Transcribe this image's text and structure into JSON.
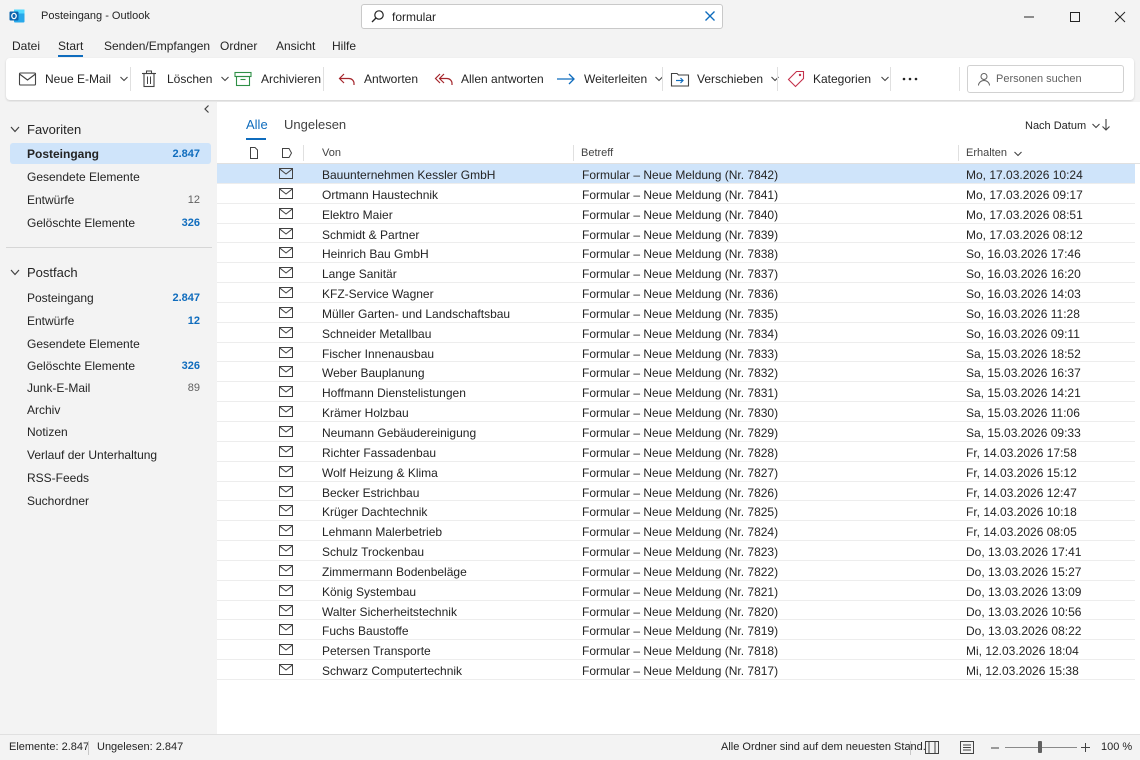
{
  "window": {
    "title": "Posteingang - Outlook",
    "search_value": "formular"
  },
  "menu": [
    "Datei",
    "Start",
    "Senden/Empfangen",
    "Ordner",
    "Ansicht",
    "Hilfe"
  ],
  "ribbon": {
    "new_mail": "Neue E-Mail",
    "delete": "Löschen",
    "archive": "Archivieren",
    "reply": "Antworten",
    "reply_all": "Allen antworten",
    "forward": "Weiterleiten",
    "move": "Verschieben",
    "categories": "Kategorien",
    "people_search": "Personen suchen"
  },
  "sidebar": {
    "favorites_title": "Favoriten",
    "favorites": [
      {
        "label": "Posteingang",
        "count": "2.847"
      },
      {
        "label": "Gesendete Elemente",
        "count": ""
      },
      {
        "label": "Entwürfe",
        "count": "12"
      },
      {
        "label": "Gelöschte Elemente",
        "count": "326"
      }
    ],
    "mailbox_title": "Postfach",
    "mailbox": [
      {
        "label": "Posteingang",
        "count": "2.847"
      },
      {
        "label": "Entwürfe",
        "count": "12"
      },
      {
        "label": "Gesendete Elemente",
        "count": ""
      },
      {
        "label": "Gelöschte Elemente",
        "count": "326"
      },
      {
        "label": "Junk-E-Mail",
        "count": "89"
      },
      {
        "label": "Archiv",
        "count": ""
      },
      {
        "label": "Notizen",
        "count": ""
      },
      {
        "label": "Verlauf der Unterhaltung",
        "count": ""
      },
      {
        "label": "RSS-Feeds",
        "count": ""
      },
      {
        "label": "Suchordner",
        "count": ""
      }
    ]
  },
  "list": {
    "tab_all": "Alle",
    "tab_unread": "Ungelesen",
    "sort_label": "Nach Datum",
    "col_from": "Von",
    "col_subject": "Betreff",
    "col_received": "Erhalten",
    "messages": [
      {
        "from": "Bauunternehmen Kessler GmbH",
        "subject": "Formular – Neue Meldung (Nr. 7842)",
        "date": "Mo, 17.03.2026 10:24"
      },
      {
        "from": "Ortmann Haustechnik",
        "subject": "Formular – Neue Meldung (Nr. 7841)",
        "date": "Mo, 17.03.2026 09:17"
      },
      {
        "from": "Elektro Maier",
        "subject": "Formular – Neue Meldung (Nr. 7840)",
        "date": "Mo, 17.03.2026 08:51"
      },
      {
        "from": "Schmidt & Partner",
        "subject": "Formular – Neue Meldung (Nr. 7839)",
        "date": "Mo, 17.03.2026 08:12"
      },
      {
        "from": "Heinrich Bau GmbH",
        "subject": "Formular – Neue Meldung (Nr. 7838)",
        "date": "So, 16.03.2026 17:46"
      },
      {
        "from": "Lange Sanitär",
        "subject": "Formular – Neue Meldung (Nr. 7837)",
        "date": "So, 16.03.2026 16:20"
      },
      {
        "from": "KFZ-Service Wagner",
        "subject": "Formular – Neue Meldung (Nr. 7836)",
        "date": "So, 16.03.2026 14:03"
      },
      {
        "from": "Müller Garten- und Landschaftsbau",
        "subject": "Formular – Neue Meldung (Nr. 7835)",
        "date": "So, 16.03.2026 11:28"
      },
      {
        "from": "Schneider Metallbau",
        "subject": "Formular – Neue Meldung (Nr. 7834)",
        "date": "So, 16.03.2026 09:11"
      },
      {
        "from": "Fischer Innenausbau",
        "subject": "Formular – Neue Meldung (Nr. 7833)",
        "date": "Sa, 15.03.2026 18:52"
      },
      {
        "from": "Weber Bauplanung",
        "subject": "Formular – Neue Meldung (Nr. 7832)",
        "date": "Sa, 15.03.2026 16:37"
      },
      {
        "from": "Hoffmann Dienstelistungen",
        "subject": "Formular – Neue Meldung (Nr. 7831)",
        "date": "Sa, 15.03.2026 14:21"
      },
      {
        "from": "Krämer Holzbau",
        "subject": "Formular – Neue Meldung (Nr. 7830)",
        "date": "Sa, 15.03.2026 11:06"
      },
      {
        "from": "Neumann Gebäudereinigung",
        "subject": "Formular – Neue Meldung (Nr. 7829)",
        "date": "Sa, 15.03.2026 09:33"
      },
      {
        "from": "Richter Fassadenbau",
        "subject": "Formular – Neue Meldung (Nr. 7828)",
        "date": "Fr, 14.03.2026 17:58"
      },
      {
        "from": "Wolf Heizung & Klima",
        "subject": "Formular – Neue Meldung (Nr. 7827)",
        "date": "Fr, 14.03.2026 15:12"
      },
      {
        "from": "Becker Estrichbau",
        "subject": "Formular – Neue Meldung (Nr. 7826)",
        "date": "Fr, 14.03.2026 12:47"
      },
      {
        "from": "Krüger Dachtechnik",
        "subject": "Formular – Neue Meldung (Nr. 7825)",
        "date": "Fr, 14.03.2026 10:18"
      },
      {
        "from": "Lehmann Malerbetrieb",
        "subject": "Formular – Neue Meldung (Nr. 7824)",
        "date": "Fr, 14.03.2026 08:05"
      },
      {
        "from": "Schulz Trockenbau",
        "subject": "Formular – Neue Meldung (Nr. 7823)",
        "date": "Do, 13.03.2026 17:41"
      },
      {
        "from": "Zimmermann Bodenbeläge",
        "subject": "Formular – Neue Meldung (Nr. 7822)",
        "date": "Do, 13.03.2026 15:27"
      },
      {
        "from": "König Systembau",
        "subject": "Formular – Neue Meldung (Nr. 7821)",
        "date": "Do, 13.03.2026 13:09"
      },
      {
        "from": "Walter Sicherheitstechnik",
        "subject": "Formular – Neue Meldung (Nr. 7820)",
        "date": "Do, 13.03.2026 10:56"
      },
      {
        "from": "Fuchs Baustoffe",
        "subject": "Formular – Neue Meldung (Nr. 7819)",
        "date": "Do, 13.03.2026 08:22"
      },
      {
        "from": "Petersen Transporte",
        "subject": "Formular – Neue Meldung (Nr. 7818)",
        "date": "Mi, 12.03.2026 18:04"
      },
      {
        "from": "Schwarz Computertechnik",
        "subject": "Formular – Neue Meldung (Nr. 7817)",
        "date": "Mi, 12.03.2026 15:38"
      }
    ]
  },
  "status": {
    "items": "Elemente: 2.847",
    "unread": "Ungelesen: 2.847",
    "sync": "Alle Ordner sind auf dem neuesten Stand.",
    "zoom": "100 %"
  },
  "colors": {
    "accent": "#0f6cbd",
    "selection": "#cfe4fa"
  }
}
